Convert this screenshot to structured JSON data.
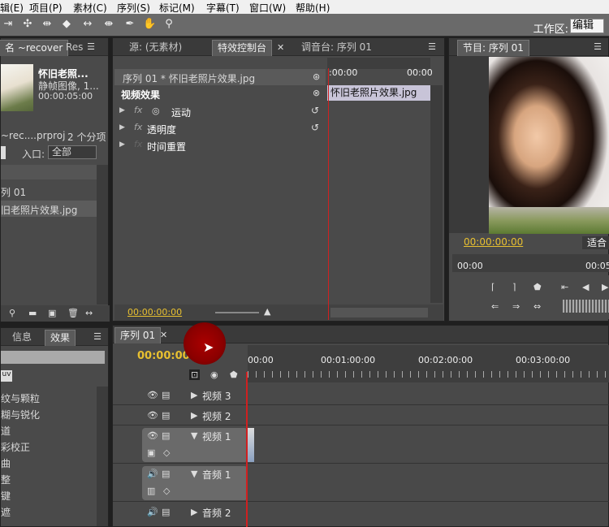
{
  "menubar": {
    "items": [
      "辑(E)",
      "项目(P)",
      "素材(C)",
      "序列(S)",
      "标记(M)",
      "字幕(T)",
      "窗口(W)",
      "帮助(H)"
    ]
  },
  "toolbar": {
    "workspace_label": "工作区:",
    "workspace_value": "编辑"
  },
  "project": {
    "tab": "名 ~recover",
    "tab2": "Res",
    "clip_name": "怀旧老照...",
    "clip_type": "静帧图像, 1...",
    "clip_duration": "00:00:05:00",
    "project_file": "~rec....prproj",
    "item_count": "2 个分项",
    "in_label": "入口:",
    "in_value": "全部",
    "items": [
      "列 01",
      "旧老照片效果.jpg"
    ]
  },
  "effect_controls": {
    "tabs": [
      "源: (无素材)",
      "特效控制台",
      "调音台: 序列 01"
    ],
    "clip_header": "序列 01 * 怀旧老照片效果.jpg",
    "section": "视频效果",
    "properties": [
      "运动",
      "透明度",
      "时间重置"
    ],
    "fx_label": "fx",
    "ruler_start": ":00:00",
    "ruler_end": "00:00",
    "clip_bar": "怀旧老照片效果.jpg",
    "timecode": "00:00:00:00"
  },
  "program": {
    "tab": "节目: 序列 01",
    "timecode": "00:00:00:00",
    "fit": "适合",
    "ruler_start": "00:00",
    "ruler_end": "00:05"
  },
  "fx_panel": {
    "tabs": [
      "信息",
      "效果"
    ],
    "items": [
      "纹与颗粒",
      "糊与锐化",
      "道",
      "彩校正",
      "曲",
      "整",
      "键",
      "遮"
    ]
  },
  "timeline": {
    "tab": "序列 01",
    "timecode": "00:00:00:00",
    "ruler": [
      "00:00",
      "00:01:00:00",
      "00:02:00:00",
      "00:03:00:00"
    ],
    "tracks": [
      "视频 3",
      "视频 2",
      "视频 1",
      "音频 1",
      "音频 2"
    ]
  }
}
